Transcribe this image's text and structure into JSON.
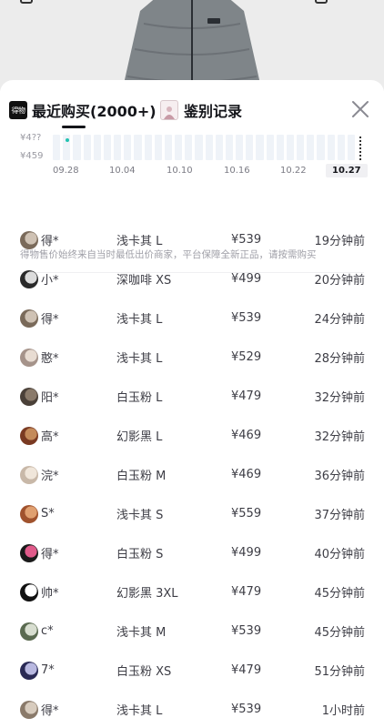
{
  "tabs": {
    "recent_logo": "得物",
    "recent_label": "最近购买(2000+)",
    "auth_label": "鉴别记录"
  },
  "chart": {
    "y_top": "¥4??",
    "y_bottom": "¥459",
    "x_labels": [
      "09.28",
      "10.04",
      "10.10",
      "10.16",
      "10.22",
      "10.27"
    ],
    "active_label": "10.27",
    "accent": "#23c2b1"
  },
  "note": "得物售价始终来自当时最低出价商家，平台保障全新正品，请按需购买",
  "purchases": [
    {
      "buyer": "得*",
      "variant": "浅卡其 L",
      "price": "¥539",
      "time": "19分钟前",
      "avatar": [
        "#7a6a5a",
        "#cfc2b4"
      ]
    },
    {
      "buyer": "小*",
      "variant": "深咖啡 XS",
      "price": "¥499",
      "time": "20分钟前",
      "avatar": [
        "#2a2a2a",
        "#dcdcdc"
      ]
    },
    {
      "buyer": "得*",
      "variant": "浅卡其 L",
      "price": "¥539",
      "time": "24分钟前",
      "avatar": [
        "#7a6a5a",
        "#cfc2b4"
      ]
    },
    {
      "buyer": "憨*",
      "variant": "浅卡其 L",
      "price": "¥529",
      "time": "28分钟前",
      "avatar": [
        "#a5938a",
        "#e8dcd2"
      ]
    },
    {
      "buyer": "阳*",
      "variant": "白玉粉 L",
      "price": "¥479",
      "time": "32分钟前",
      "avatar": [
        "#4a4038",
        "#8a7a6a"
      ]
    },
    {
      "buyer": "高*",
      "variant": "幻影黑 L",
      "price": "¥469",
      "time": "32分钟前",
      "avatar": [
        "#7a3a22",
        "#c48a5a"
      ]
    },
    {
      "buyer": "浣*",
      "variant": "白玉粉 M",
      "price": "¥469",
      "time": "36分钟前",
      "avatar": [
        "#c8b8a8",
        "#f0e6da"
      ]
    },
    {
      "buyer": "S*",
      "variant": "浅卡其 S",
      "price": "¥559",
      "time": "37分钟前",
      "avatar": [
        "#a0522d",
        "#e0a070"
      ]
    },
    {
      "buyer": "得*",
      "variant": "白玉粉 S",
      "price": "¥499",
      "time": "40分钟前",
      "avatar": [
        "#1a1a1a",
        "#e05a8a"
      ]
    },
    {
      "buyer": "帅*",
      "variant": "幻影黑 3XL",
      "price": "¥479",
      "time": "45分钟前",
      "avatar": [
        "#111111",
        "#ffffff"
      ]
    },
    {
      "buyer": "c*",
      "variant": "浅卡其 M",
      "price": "¥539",
      "time": "45分钟前",
      "avatar": [
        "#5a6a50",
        "#d8ded0"
      ]
    },
    {
      "buyer": "7*",
      "variant": "白玉粉 XS",
      "price": "¥479",
      "time": "51分钟前",
      "avatar": [
        "#2a2a55",
        "#b8b8e0"
      ]
    },
    {
      "buyer": "得*",
      "variant": "浅卡其 L",
      "price": "¥539",
      "time": "1小时前",
      "avatar": [
        "#8a7a6a",
        "#d8ccbe"
      ]
    }
  ]
}
